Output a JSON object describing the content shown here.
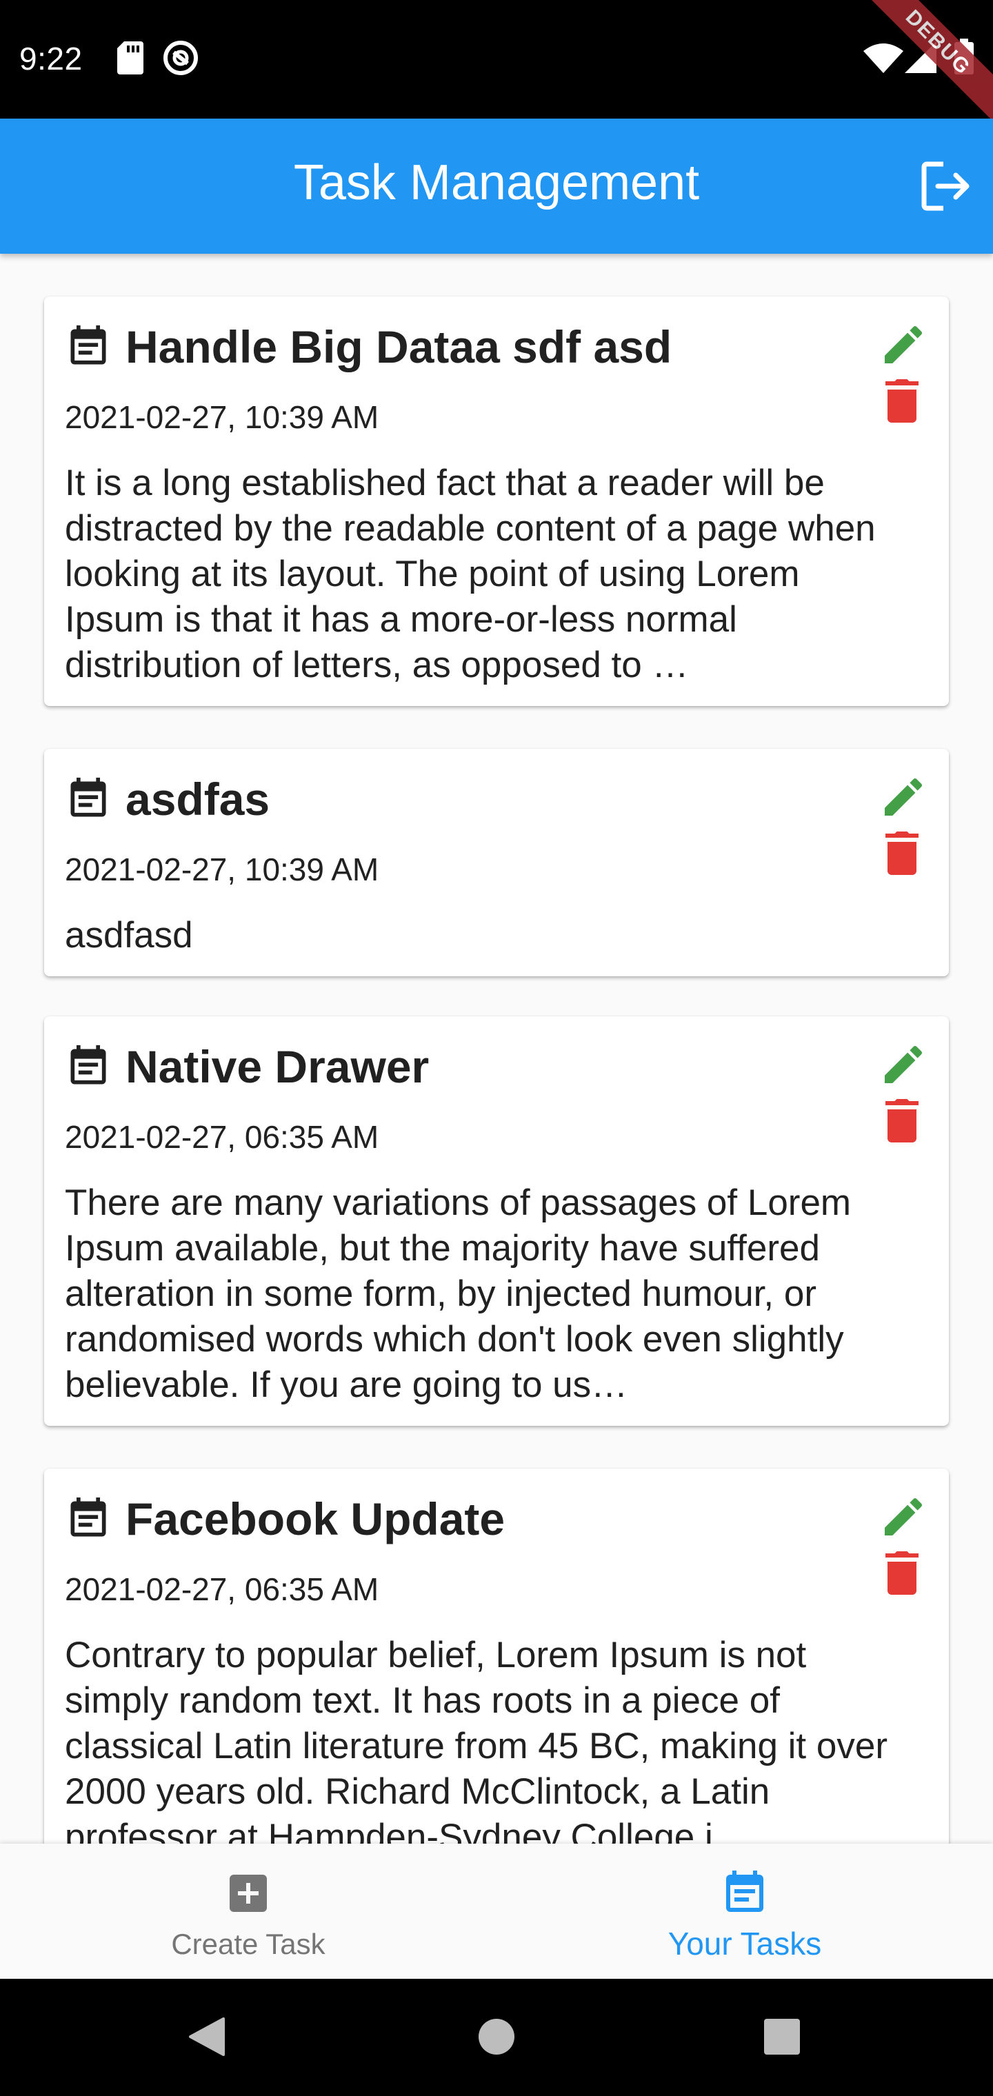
{
  "status_bar": {
    "time": "9:22",
    "debug_label": "DEBUG"
  },
  "app_bar": {
    "title": "Task Management"
  },
  "colors": {
    "primary": "#2196f3",
    "edit": "#43a047",
    "delete": "#e53935"
  },
  "tasks": [
    {
      "title": "Handle Big Dataa sdf asd",
      "date": "2021-02-27, 10:39 AM",
      "description": "It is a long established fact that a reader will be distracted by the readable content of a page when looking at its layout. The point of using Lorem Ipsum is that it has a more-or-less normal distribution of letters, as opposed to …"
    },
    {
      "title": "asdfas",
      "date": "2021-02-27, 10:39 AM",
      "description": "asdfasd"
    },
    {
      "title": "Native Drawer",
      "date": "2021-02-27, 06:35 AM",
      "description": "There are many variations of passages of Lorem Ipsum available, but the majority have suffered alteration in some form, by injected humour, or randomised words which don't look even slightly believable. If you are going to us…"
    },
    {
      "title": "Facebook Update",
      "date": "2021-02-27, 06:35 AM",
      "description": "Contrary to popular belief, Lorem Ipsum is not simply random text. It has roots in a piece of classical Latin literature from 45 BC, making it over 2000 years old. Richard McClintock, a Latin professor at Hampden-Sydney College i…"
    }
  ],
  "bottom_nav": {
    "items": [
      {
        "label": "Create Task",
        "icon": "add-box-icon",
        "active": false
      },
      {
        "label": "Your Tasks",
        "icon": "calendar-list-icon",
        "active": true
      }
    ]
  }
}
